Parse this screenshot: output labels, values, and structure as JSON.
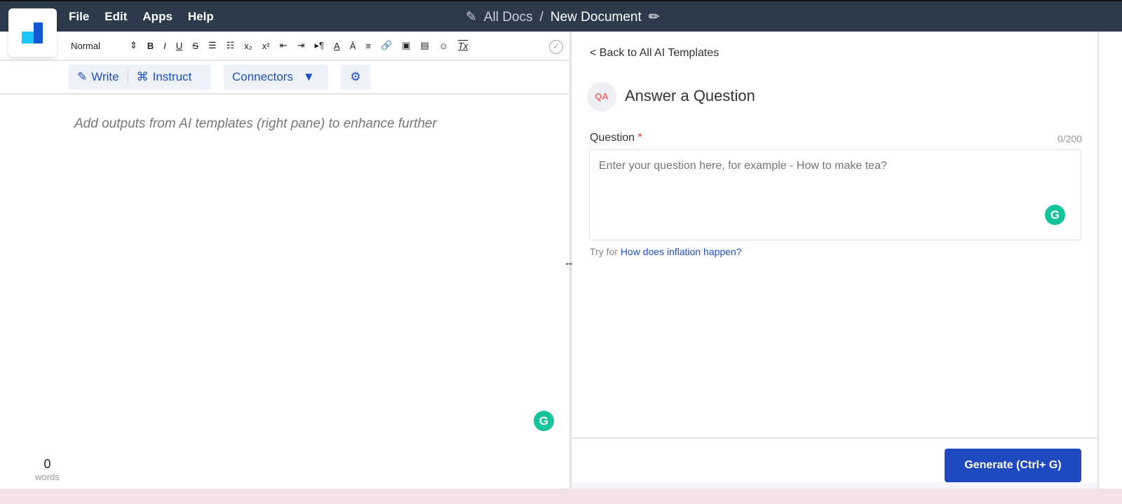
{
  "menu": [
    "File",
    "Edit",
    "Apps",
    "Help"
  ],
  "breadcrumb": {
    "all_docs": "All Docs",
    "sep": "/",
    "doc": "New Document"
  },
  "toolbar": {
    "style": "Normal",
    "items": [
      "⇕",
      "B",
      "I",
      "U",
      "S",
      "☰",
      "☷",
      "x₂",
      "x²",
      "⇤",
      "⇥",
      "▸¶",
      "A",
      "Ā",
      "≡",
      "🔗",
      "▣",
      "▤",
      "☺",
      "Tx"
    ],
    "check": "✓"
  },
  "ai_bar": {
    "write": "Write",
    "instruct": "Instruct",
    "connectors": "Connectors"
  },
  "editor": {
    "placeholder": "Add outputs from AI templates (right pane) to enhance further",
    "grammarly": "G"
  },
  "word_count": {
    "value": "0",
    "label": "words"
  },
  "right": {
    "back": "< Back to All AI Templates",
    "title": "Answer a Question",
    "icon": "QA",
    "question_label": "Question",
    "required": "*",
    "counter": "0/200",
    "placeholder": "Enter your question here, for example - How to make tea?",
    "try_prefix": "Try for",
    "try_link": "How does inflation happen?",
    "generate": "Generate (Ctrl+ G)"
  }
}
